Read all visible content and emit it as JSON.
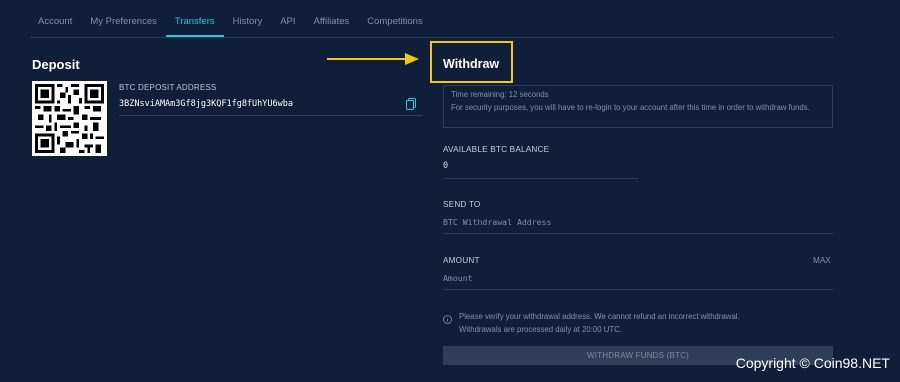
{
  "tabs": [
    {
      "label": "Account"
    },
    {
      "label": "My Preferences"
    },
    {
      "label": "Transfers",
      "active": true
    },
    {
      "label": "History"
    },
    {
      "label": "API"
    },
    {
      "label": "Affiliates"
    },
    {
      "label": "Competitions"
    }
  ],
  "deposit": {
    "title": "Deposit",
    "address_label": "BTC DEPOSIT ADDRESS",
    "address_value": "3BZNsviAMAm3Gf8jg3KQF1fg8fUhYU6wba",
    "copy_icon": "copy-icon"
  },
  "withdraw": {
    "title": "Withdraw",
    "notice_line1": "Time remaining: 12 seconds",
    "notice_line2": "For security purposes, you will have to re-login to your account after this time in order to withdraw funds.",
    "balance_label": "AVAILABLE BTC BALANCE",
    "balance_value": "0",
    "send_to_label": "SEND TO",
    "send_to_placeholder": "BTC Withdrawal Address",
    "amount_label": "AMOUNT",
    "amount_max": "MAX",
    "amount_placeholder": "Amount",
    "info_line1": "Please verify your withdrawal address. We cannot refund an incorrect withdrawal.",
    "info_line2": "Withdrawals are processed daily at 20:00 UTC.",
    "button_label": "WITHDRAW FUNDS (BTC)"
  },
  "watermark": "Copyright © Coin98.NET",
  "colors": {
    "background": "#0f1f3a",
    "accent": "#21c8d8",
    "highlight": "#f5c518",
    "muted": "#8290a8"
  }
}
